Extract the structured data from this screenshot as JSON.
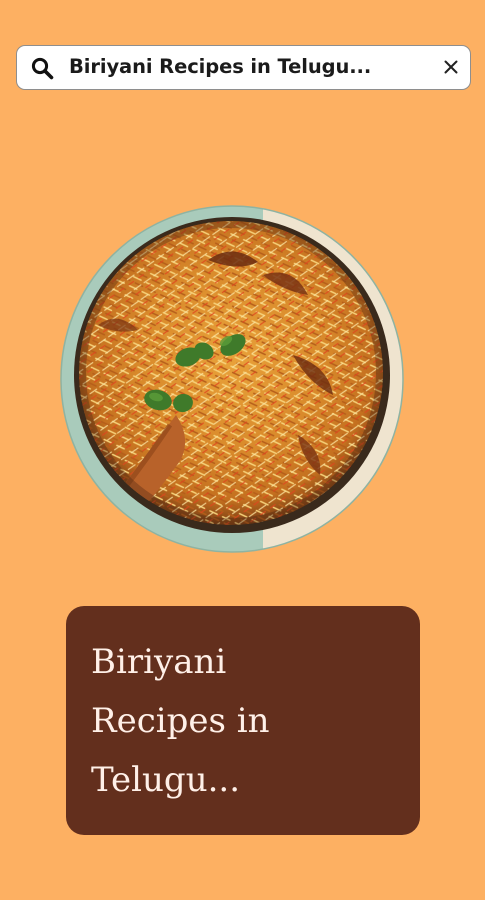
{
  "search": {
    "query": "Biriyani Recipes in Telugu..."
  },
  "icons": {
    "search": "search-icon",
    "close": "close-icon"
  },
  "hero_image": {
    "subject": "chicken biryani bowl"
  },
  "title_card": {
    "lines": [
      "Biriyani",
      "Recipes in",
      "Telugu..."
    ]
  },
  "colors": {
    "background": "#FDB062",
    "card": "#632F1D",
    "card_text": "#FFF0E8"
  }
}
